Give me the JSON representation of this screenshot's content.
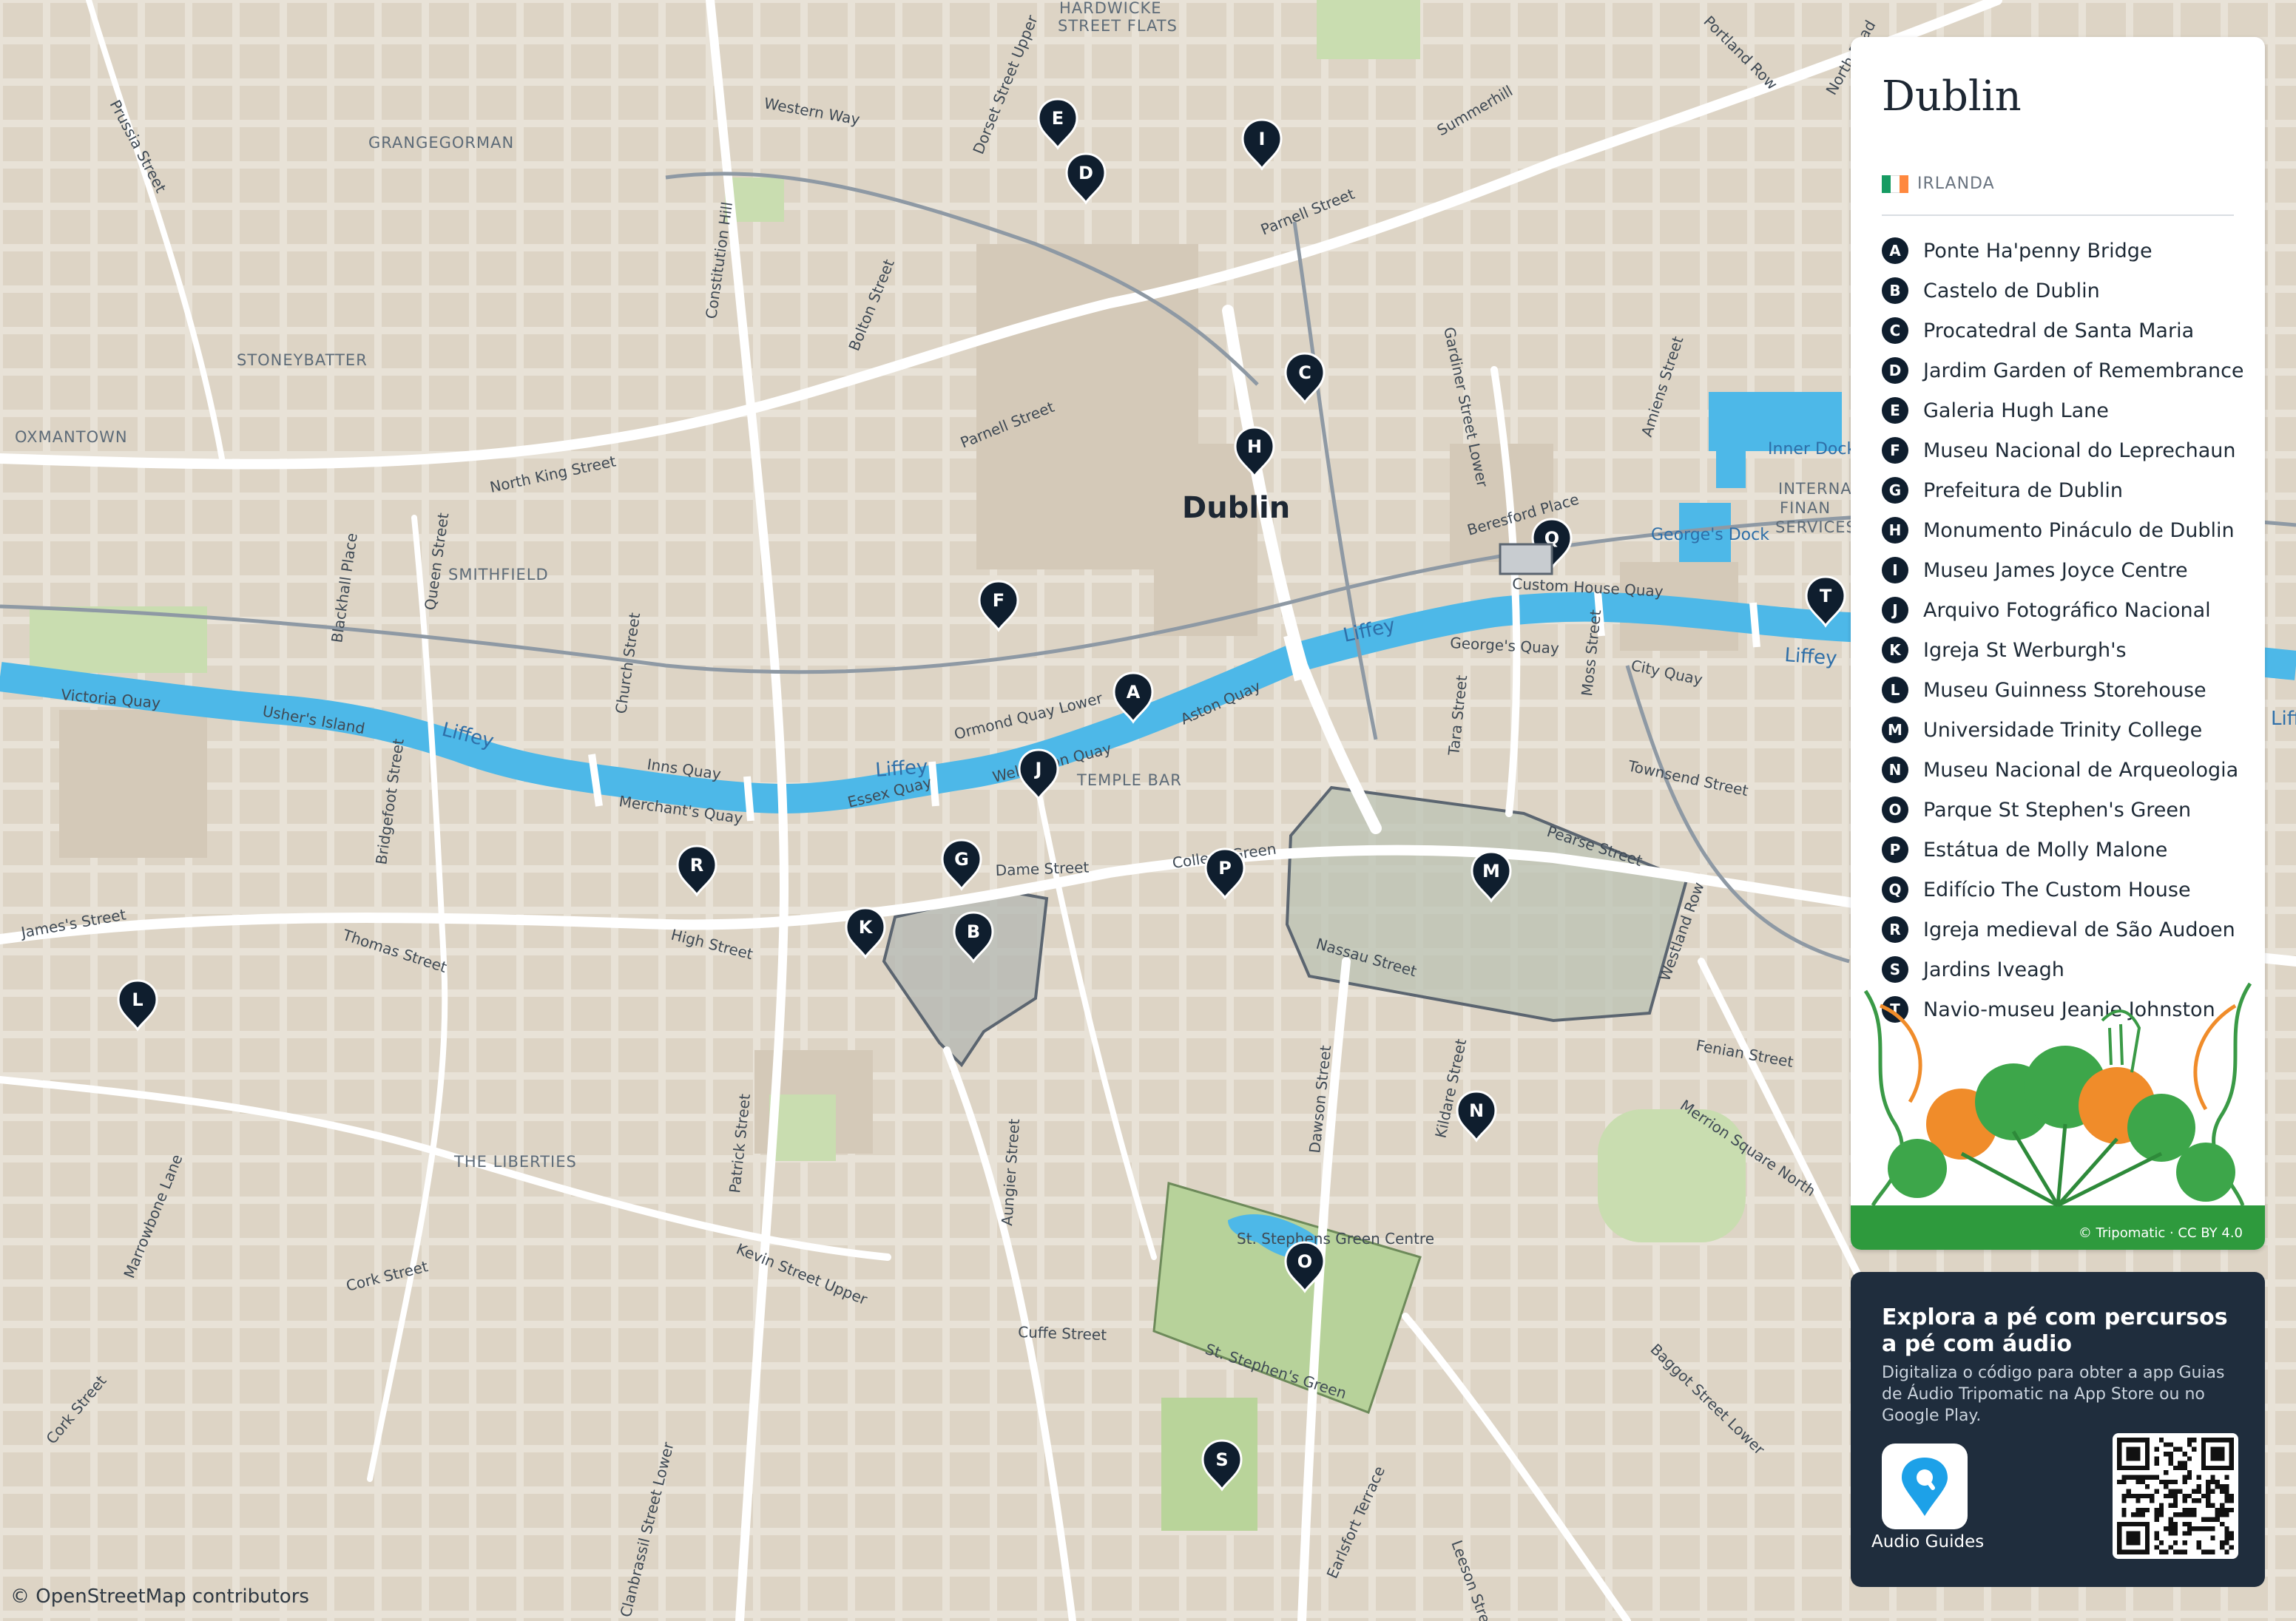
{
  "map": {
    "city_label": "Dublin",
    "attribution": "© OpenStreetMap contributors",
    "colors": {
      "land": "#e8e2d7",
      "block": "#d9cfbf",
      "water": "#4db8e8",
      "park": "#c9ddb0",
      "road": "#ffffff",
      "rail": "#9aa3ad",
      "marker": "#0f1e2e"
    },
    "districts": [
      {
        "id": "grangegorman",
        "text": "GRANGEGORMAN"
      },
      {
        "id": "stoneybatter",
        "text": "STONEYBATTER"
      },
      {
        "id": "oxmantown",
        "text": "OXMANTOWN"
      },
      {
        "id": "smithfield",
        "text": "SMITHFIELD"
      },
      {
        "id": "temple-bar",
        "text": "TEMPLE BAR"
      },
      {
        "id": "the-liberties",
        "text": "THE LIBERTIES"
      },
      {
        "id": "hardwicke",
        "text": "HARDWICKE"
      },
      {
        "id": "street-flats",
        "text": "STREET FLATS"
      },
      {
        "id": "internat",
        "text": "INTERNAT"
      },
      {
        "id": "finan",
        "text": "FINAN"
      },
      {
        "id": "services",
        "text": "SERVICES"
      }
    ],
    "streets": [
      {
        "id": "western-way",
        "text": "Western Way"
      },
      {
        "id": "dorset-street",
        "text": "Dorset Street Upper"
      },
      {
        "id": "summerhill",
        "text": "Summerhill"
      },
      {
        "id": "portland-row",
        "text": "Portland Row"
      },
      {
        "id": "north-road",
        "text": "North Road"
      },
      {
        "id": "parnell-street-e",
        "text": "Parnell Street"
      },
      {
        "id": "parnell-street-w",
        "text": "Parnell Street"
      },
      {
        "id": "bolton-street",
        "text": "Bolton Street"
      },
      {
        "id": "constitution-hill",
        "text": "Constitution Hill"
      },
      {
        "id": "prussia-street",
        "text": "Prussia Street"
      },
      {
        "id": "north-king-street",
        "text": "North King Street"
      },
      {
        "id": "queen-street",
        "text": "Queen Street"
      },
      {
        "id": "blackhall-place",
        "text": "Blackhall Place"
      },
      {
        "id": "church-street",
        "text": "Church Street"
      },
      {
        "id": "gardiner-street",
        "text": "Gardiner Street Lower"
      },
      {
        "id": "amiens-street",
        "text": "Amiens Street"
      },
      {
        "id": "beresford-place",
        "text": "Beresford Place"
      },
      {
        "id": "custom-house-quay",
        "text": "Custom House Quay"
      },
      {
        "id": "georges-quay",
        "text": "George's Quay"
      },
      {
        "id": "city-quay",
        "text": "City Quay"
      },
      {
        "id": "moss-street",
        "text": "Moss Street"
      },
      {
        "id": "tara-street",
        "text": "Tara Street"
      },
      {
        "id": "townsend-street",
        "text": "Townsend Street"
      },
      {
        "id": "victoria-quay",
        "text": "Victoria Quay"
      },
      {
        "id": "ushers-island",
        "text": "Usher's Island"
      },
      {
        "id": "inns-quay",
        "text": "Inns Quay"
      },
      {
        "id": "merchants-quay",
        "text": "Merchant's Quay"
      },
      {
        "id": "essex-quay",
        "text": "Essex Quay"
      },
      {
        "id": "ormond-quay",
        "text": "Ormond Quay Lower"
      },
      {
        "id": "aston-quay",
        "text": "Aston Quay"
      },
      {
        "id": "wellington-quay",
        "text": "Wellington Quay"
      },
      {
        "id": "bridgefoot-street",
        "text": "Bridgefoot Street"
      },
      {
        "id": "james-street",
        "text": "James's Street"
      },
      {
        "id": "thomas-street",
        "text": "Thomas Street"
      },
      {
        "id": "high-street",
        "text": "High Street"
      },
      {
        "id": "dame-street",
        "text": "Dame Street"
      },
      {
        "id": "college-green",
        "text": "College Green"
      },
      {
        "id": "pearse-street",
        "text": "Pearse Street"
      },
      {
        "id": "westland-row",
        "text": "Westland Row"
      },
      {
        "id": "nassau-street",
        "text": "Nassau Street"
      },
      {
        "id": "fenian-street",
        "text": "Fenian Street"
      },
      {
        "id": "merrion-square-north",
        "text": "Merrion Square North"
      },
      {
        "id": "kildare-street",
        "text": "Kildare Street"
      },
      {
        "id": "dawson-street",
        "text": "Dawson Street"
      },
      {
        "id": "aungier-street",
        "text": "Aungier Street"
      },
      {
        "id": "patrick-street",
        "text": "Patrick Street"
      },
      {
        "id": "kevin-street",
        "text": "Kevin Street Upper"
      },
      {
        "id": "cuffe-street",
        "text": "Cuffe Street"
      },
      {
        "id": "st-stephens-green-st",
        "text": "St. Stephen's Green"
      },
      {
        "id": "marrowbone-lane",
        "text": "Marrowbone Lane"
      },
      {
        "id": "cork-street",
        "text": "Cork Street"
      },
      {
        "id": "cork-street-2",
        "text": "Cork Street"
      },
      {
        "id": "baggot-street",
        "text": "Baggot Street Lower"
      },
      {
        "id": "earlsfort-terrace",
        "text": "Earlsfort Terrace"
      },
      {
        "id": "leeson-street",
        "text": "Leeson Street"
      },
      {
        "id": "clanbrassil-street",
        "text": "Clanbrassil Street Lower"
      },
      {
        "id": "st-stephens-green-label",
        "text": "St. Stephens Green Centre"
      }
    ],
    "water_labels": [
      {
        "id": "liffey-1",
        "text": "Liffey"
      },
      {
        "id": "liffey-2",
        "text": "Liffey"
      },
      {
        "id": "liffey-3",
        "text": "Liffey"
      },
      {
        "id": "liffey-4",
        "text": "Liffey"
      },
      {
        "id": "liffey-5",
        "text": "Liffe"
      },
      {
        "id": "inner-dock",
        "text": "Inner Dock"
      },
      {
        "id": "georges-dock",
        "text": "George's Dock"
      }
    ],
    "markers": [
      {
        "letter": "A"
      },
      {
        "letter": "B"
      },
      {
        "letter": "C"
      },
      {
        "letter": "D"
      },
      {
        "letter": "E"
      },
      {
        "letter": "F"
      },
      {
        "letter": "G"
      },
      {
        "letter": "H"
      },
      {
        "letter": "I"
      },
      {
        "letter": "J"
      },
      {
        "letter": "K"
      },
      {
        "letter": "L"
      },
      {
        "letter": "M"
      },
      {
        "letter": "N"
      },
      {
        "letter": "O"
      },
      {
        "letter": "P"
      },
      {
        "letter": "Q"
      },
      {
        "letter": "R"
      },
      {
        "letter": "S"
      },
      {
        "letter": "T"
      }
    ]
  },
  "legend": {
    "city": "Dublin",
    "country": "IRLANDA",
    "flag_colors": [
      "#169b62",
      "#ffffff",
      "#ff883e"
    ],
    "items": [
      {
        "letter": "A",
        "name": "Ponte Ha'penny Bridge"
      },
      {
        "letter": "B",
        "name": "Castelo de Dublin"
      },
      {
        "letter": "C",
        "name": "Procatedral de Santa Maria"
      },
      {
        "letter": "D",
        "name": "Jardim Garden of Remembrance"
      },
      {
        "letter": "E",
        "name": "Galeria Hugh Lane"
      },
      {
        "letter": "F",
        "name": "Museu Nacional do Leprechaun"
      },
      {
        "letter": "G",
        "name": "Prefeitura de Dublin"
      },
      {
        "letter": "H",
        "name": "Monumento Pináculo de Dublin"
      },
      {
        "letter": "I",
        "name": "Museu James Joyce Centre"
      },
      {
        "letter": "J",
        "name": "Arquivo Fotográfico Nacional"
      },
      {
        "letter": "K",
        "name": "Igreja St Werburgh's"
      },
      {
        "letter": "L",
        "name": "Museu Guinness Storehouse"
      },
      {
        "letter": "M",
        "name": "Universidade Trinity College"
      },
      {
        "letter": "N",
        "name": "Museu Nacional de Arqueologia"
      },
      {
        "letter": "O",
        "name": "Parque St Stephen's Green"
      },
      {
        "letter": "P",
        "name": "Estátua de Molly Malone"
      },
      {
        "letter": "Q",
        "name": "Edifício The Custom House"
      },
      {
        "letter": "R",
        "name": "Igreja medieval de São Audoen"
      },
      {
        "letter": "S",
        "name": "Jardins Iveagh"
      },
      {
        "letter": "T",
        "name": "Navio-museu Jeanie Johnston"
      }
    ],
    "credit": "© Tripomatic · CC BY 4.0"
  },
  "promo": {
    "title": "Explora a pé com percursos a pé com áudio",
    "text": "Digitaliza o código para obter a app Guias de Áudio Tripomatic na App Store ou no Google Play.",
    "app_label": "Audio Guides",
    "app_icon": "location-pin-icon"
  }
}
